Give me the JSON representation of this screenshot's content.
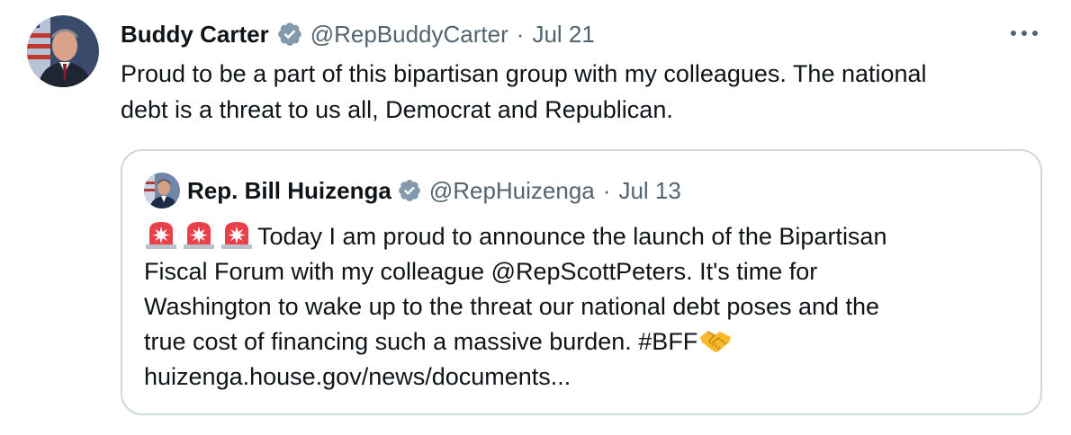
{
  "tweet": {
    "author_name": "Buddy Carter",
    "author_handle": "@RepBuddyCarter",
    "separator": "·",
    "date": "Jul 21",
    "text_lines": [
      "Proud to be a part of this bipartisan group with my colleagues. The national",
      "debt is a threat to us all, Democrat and Republican."
    ],
    "more_icon": "more-horizontal-icon",
    "verified_color": "#829aab"
  },
  "quote": {
    "author_name": "Rep. Bill Huizenga",
    "author_handle": "@RepHuizenga",
    "separator": "·",
    "date": "Jul 13",
    "emoji_prefix_icons": [
      "police-siren-icon",
      "police-siren-icon",
      "police-siren-icon"
    ],
    "text_lines": [
      "Today I am proud to announce the launch of the Bipartisan",
      "Fiscal Forum with my colleague @RepScottPeters.  It's time for",
      "Washington to wake up to the threat our national debt poses and the",
      "true cost of financing such a massive burden. #BFF",
      "huizenga.house.gov/news/documents..."
    ],
    "emoji_suffix_icon": "handshake-icon"
  },
  "colors": {
    "text_primary": "#0f1419",
    "text_secondary": "#536471",
    "border": "#cfd9de"
  }
}
